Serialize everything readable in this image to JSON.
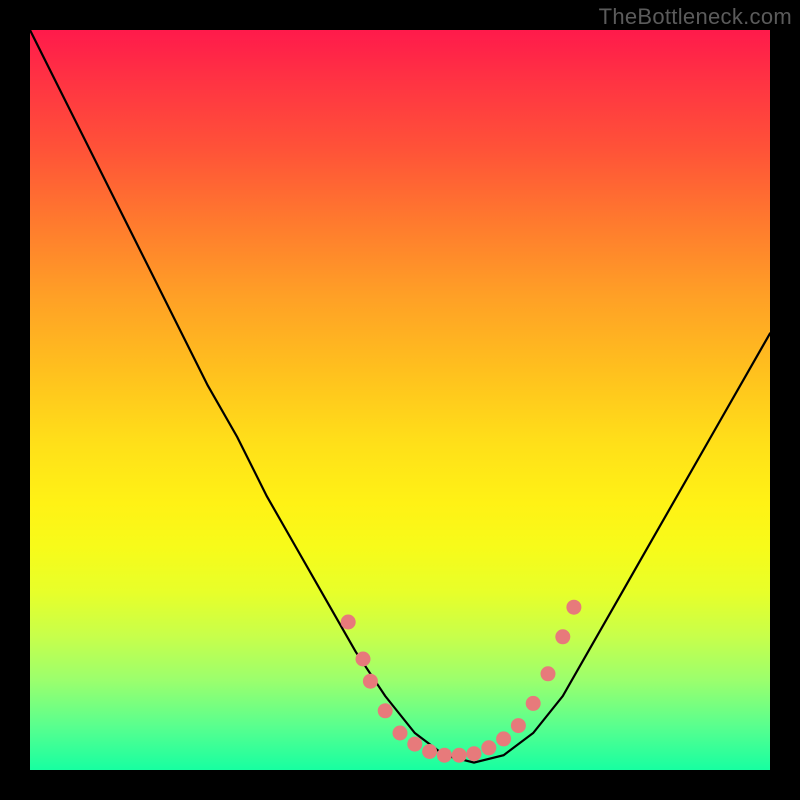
{
  "watermark": "TheBottleneck.com",
  "colors": {
    "dot": "#e77a7b",
    "curve": "#000000",
    "background": "#000000"
  },
  "chart_data": {
    "type": "line",
    "title": "",
    "xlabel": "",
    "ylabel": "",
    "xlim": [
      0,
      100
    ],
    "ylim": [
      0,
      100
    ],
    "note": "No axes, ticks, or labels are drawn; values below are visual estimates where y=0 is the bottom edge and y=100 is the top edge of the colored area.",
    "series": [
      {
        "name": "bottleneck-curve",
        "x": [
          0,
          4,
          8,
          12,
          16,
          20,
          24,
          28,
          32,
          36,
          40,
          44,
          48,
          52,
          56,
          60,
          64,
          68,
          72,
          76,
          80,
          84,
          88,
          92,
          96,
          100
        ],
        "y": [
          100,
          92,
          84,
          76,
          68,
          60,
          52,
          45,
          37,
          30,
          23,
          16,
          10,
          5,
          2,
          1,
          2,
          5,
          10,
          17,
          24,
          31,
          38,
          45,
          52,
          59
        ]
      }
    ],
    "highlight_dots": {
      "description": "Salmon dots near curve minimum region",
      "points": [
        {
          "x": 43,
          "y": 20
        },
        {
          "x": 45,
          "y": 15
        },
        {
          "x": 46,
          "y": 12
        },
        {
          "x": 48,
          "y": 8
        },
        {
          "x": 50,
          "y": 5
        },
        {
          "x": 52,
          "y": 3.5
        },
        {
          "x": 54,
          "y": 2.5
        },
        {
          "x": 56,
          "y": 2
        },
        {
          "x": 58,
          "y": 2
        },
        {
          "x": 60,
          "y": 2.2
        },
        {
          "x": 62,
          "y": 3
        },
        {
          "x": 64,
          "y": 4.2
        },
        {
          "x": 66,
          "y": 6
        },
        {
          "x": 68,
          "y": 9
        },
        {
          "x": 70,
          "y": 13
        },
        {
          "x": 72,
          "y": 18
        },
        {
          "x": 73.5,
          "y": 22
        }
      ]
    }
  }
}
